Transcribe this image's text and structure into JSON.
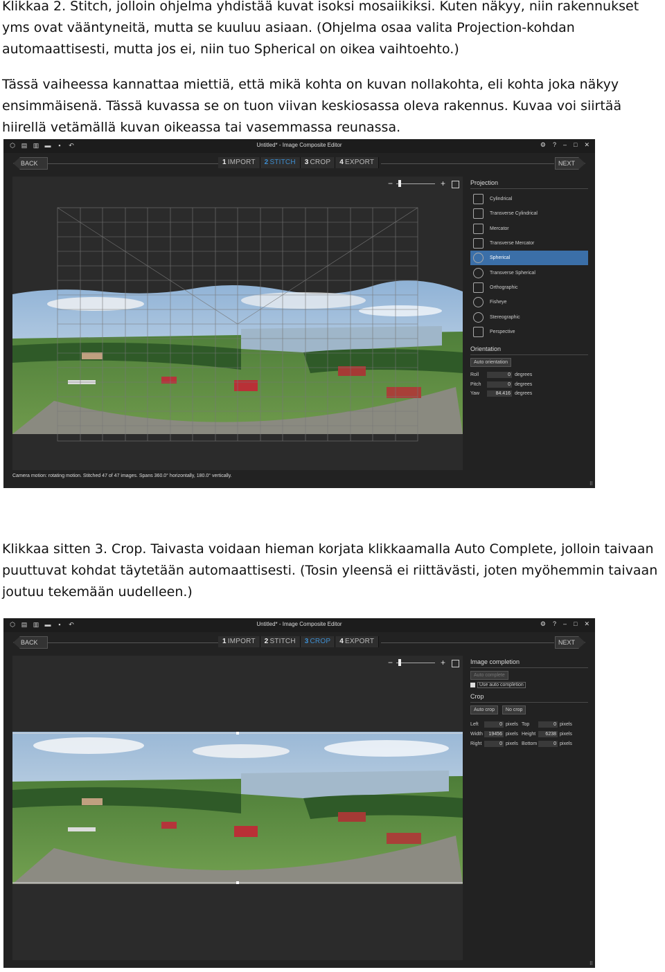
{
  "paragraphs": {
    "p1": "Klikkaa 2. Stitch, jolloin ohjelma yhdistää kuvat isoksi mosaiikiksi. Kuten näkyy, niin rakennukset yms ovat vääntyneitä, mutta se kuuluu asiaan. (Ohjelma osaa valita Projection-kohdan automaattisesti, mutta jos ei, niin tuo Spherical on oikea vaihtoehto.)",
    "p2": "Tässä vaiheessa kannattaa miettiä, että mikä kohta on kuvan nollakohta, eli kohta joka näkyy ensimmäisenä. Tässä kuvassa se on tuon viivan keskiosassa oleva rakennus. Kuvaa voi siirtää hiirellä vetämällä kuvan oikeassa tai vasemmassa reunassa.",
    "p3": "Klikkaa sitten 3. Crop. Taivasta voidaan hieman korjata klikkaamalla Auto Complete, jolloin taivaan puuttuvat kohdat täytetään automaattisesti. (Tosin yleensä ei riittävästi, joten myöhemmin taivaan joutuu tekemään uudelleen.)"
  },
  "window": {
    "title": "Untitled* - Image Composite Editor",
    "back_label": "BACK",
    "next_label": "NEXT",
    "steps": [
      {
        "num": "1",
        "label": "IMPORT"
      },
      {
        "num": "2",
        "label": "STITCH"
      },
      {
        "num": "3",
        "label": "CROP"
      },
      {
        "num": "4",
        "label": "EXPORT"
      }
    ],
    "controls": {
      "settings": "⚙",
      "help": "?",
      "minimize": "–",
      "maximize": "□",
      "close": "✕"
    }
  },
  "shot1": {
    "active_step": 1,
    "status": "Camera motion: rotating motion. Stitched 47 of 47 images. Spans 360.0° horizontally, 180.0° vertically.",
    "projection": {
      "title": "Projection",
      "selected": "Spherical",
      "items": [
        "Cylindrical",
        "Transverse Cylindrical",
        "Mercator",
        "Transverse Mercator",
        "Spherical",
        "Transverse Spherical",
        "Orthographic",
        "Fisheye",
        "Stereographic",
        "Perspective"
      ]
    },
    "orientation": {
      "title": "Orientation",
      "auto_button": "Auto orientation",
      "unit": "degrees",
      "fields": [
        {
          "label": "Roll",
          "value": "0"
        },
        {
          "label": "Pitch",
          "value": "0"
        },
        {
          "label": "Yaw",
          "value": "84.416"
        }
      ]
    }
  },
  "shot2": {
    "active_step": 2,
    "image_completion": {
      "title": "Image completion",
      "auto_complete_button": "Auto complete",
      "use_auto_label": "Use auto completion"
    },
    "crop": {
      "title": "Crop",
      "auto_crop_button": "Auto crop",
      "no_crop_button": "No crop",
      "unit": "pixels",
      "left": {
        "label": "Left",
        "value": "0"
      },
      "top": {
        "label": "Top",
        "value": "0"
      },
      "width": {
        "label": "Width",
        "value": "19456"
      },
      "height": {
        "label": "Height",
        "value": "6238"
      },
      "right": {
        "label": "Right",
        "value": "0"
      },
      "bottom": {
        "label": "Bottom",
        "value": "0"
      }
    }
  },
  "colors": {
    "accent": "#3e8ed0",
    "selection": "#3b6fa8",
    "background": "#222222"
  }
}
